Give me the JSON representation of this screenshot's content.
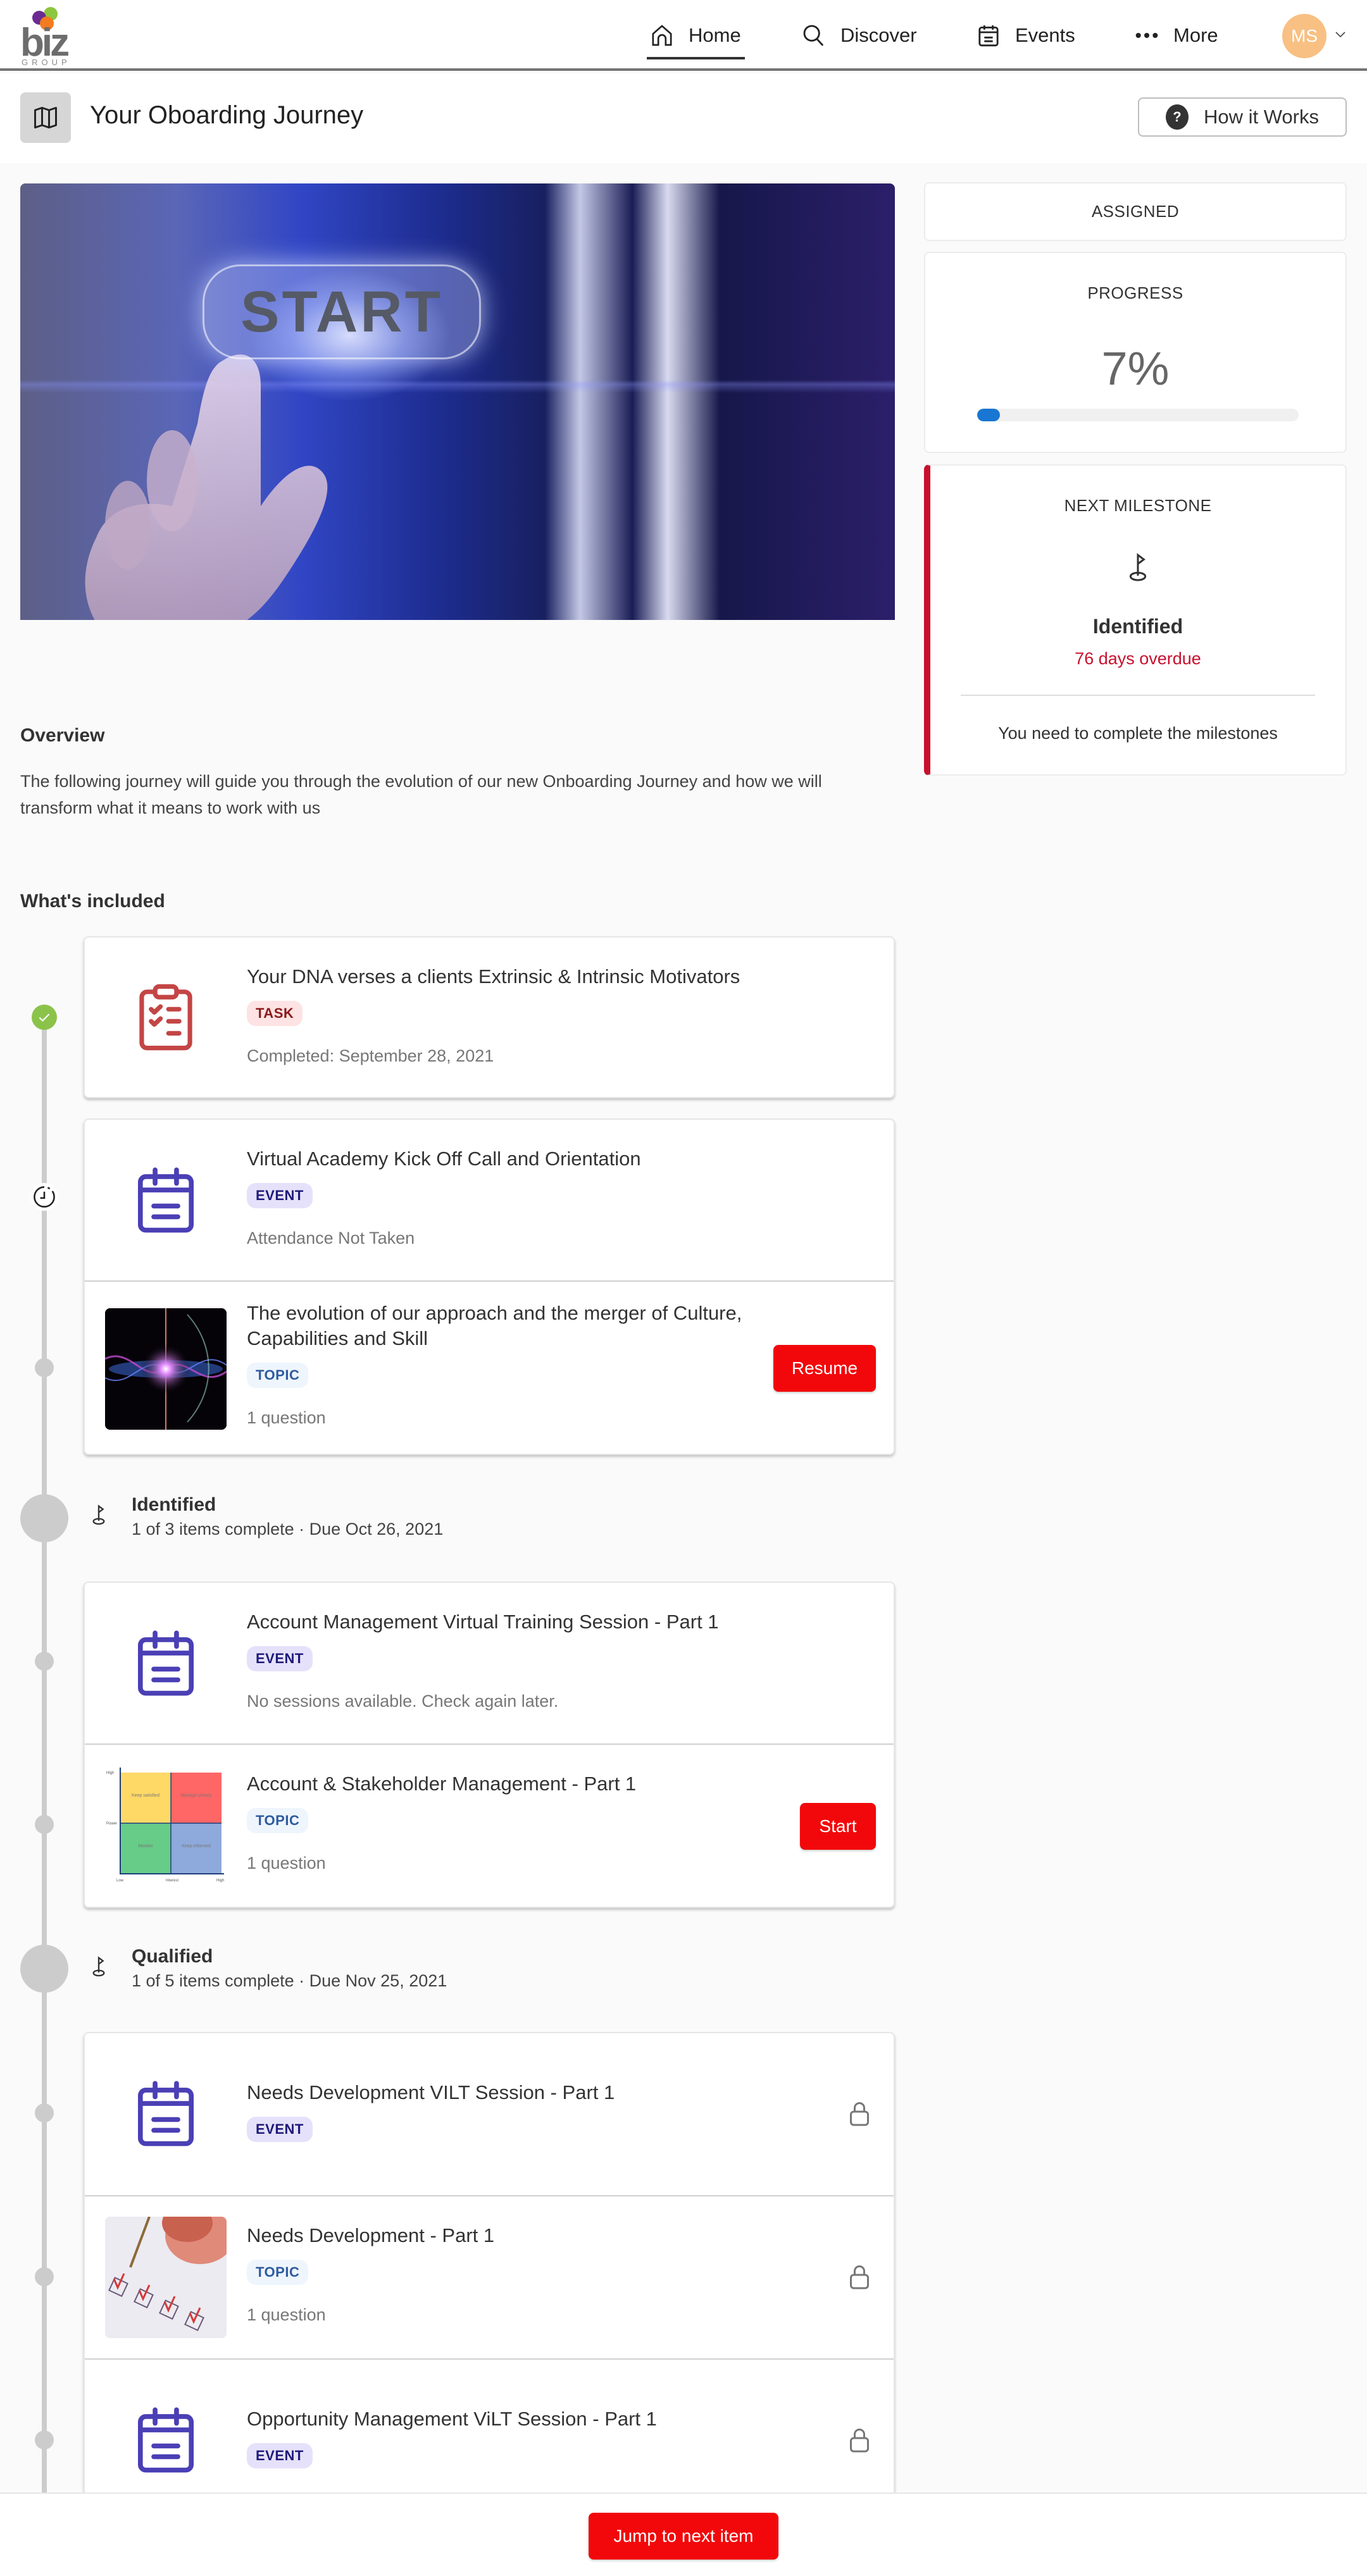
{
  "nav": {
    "logo_text": "biz",
    "logo_subtext": "GROUP",
    "items": [
      {
        "label": "Home",
        "icon": "home-icon",
        "active": true
      },
      {
        "label": "Discover",
        "icon": "search-icon",
        "active": false
      },
      {
        "label": "Events",
        "icon": "calendar-icon",
        "active": false
      },
      {
        "label": "More",
        "icon": "more-dots-icon",
        "active": false
      }
    ],
    "avatar_initials": "MS"
  },
  "header": {
    "title": "Your Oboarding Journey",
    "how_it_works_label": "How it Works"
  },
  "hero": {
    "image_text": "START"
  },
  "sidebar": {
    "status_label": "ASSIGNED",
    "progress_label": "PROGRESS",
    "progress_value": "7%",
    "progress_fraction": 0.07,
    "next_milestone_label": "NEXT MILESTONE",
    "next_milestone_name": "Identified",
    "next_milestone_overdue": "76 days overdue",
    "next_milestone_note": "You need to complete the milestones"
  },
  "overview": {
    "heading": "Overview",
    "text": "The following journey will guide you through the evolution of our new Onboarding Journey and how we will transform what it means to work with us"
  },
  "included": {
    "heading": "What's included",
    "groups": [
      {
        "items": [
          {
            "title": "Your DNA verses a clients Extrinsic & Intrinsic Motivators",
            "tag": "TASK",
            "meta": "Completed: September 28, 2021",
            "status": "completed"
          }
        ]
      },
      {
        "items": [
          {
            "title": "Virtual Academy Kick Off Call and Orientation",
            "tag": "EVENT",
            "meta": "Attendance Not Taken",
            "status": "pending"
          },
          {
            "title": "The evolution of our approach and the merger of Culture, Capabilities and Skill",
            "tag": "TOPIC",
            "meta": "1 question",
            "action": "Resume"
          }
        ]
      }
    ],
    "milestones": [
      {
        "name": "Identified",
        "summary": "1 of 3 items complete · Due Oct 26, 2021",
        "items": [
          {
            "title": "Account Management Virtual Training Session - Part 1",
            "tag": "EVENT",
            "meta": "No sessions available. Check again later."
          },
          {
            "title": "Account & Stakeholder Management - Part 1",
            "tag": "TOPIC",
            "meta": "1 question",
            "action": "Start",
            "thumb_labels": {
              "q1": "Keep satisfied",
              "q2": "Manage closely",
              "q3": "Monitor",
              "q4": "Keep informed",
              "y_high": "High",
              "y_mid": "Power",
              "x_low": "Low",
              "x_mid": "Interest",
              "x_high": "High"
            }
          }
        ]
      },
      {
        "name": "Qualified",
        "summary": "1 of 5 items complete · Due Nov 25, 2021",
        "items": [
          {
            "title": "Needs Development VILT Session - Part 1",
            "tag": "EVENT",
            "meta": "",
            "locked": true
          },
          {
            "title": "Needs Development - Part 1",
            "tag": "TOPIC",
            "meta": "1 question",
            "locked": true
          },
          {
            "title": "Opportunity Management ViLT Session - Part 1",
            "tag": "EVENT",
            "meta": "",
            "locked": true
          }
        ]
      }
    ]
  },
  "footer": {
    "jump_label": "Jump to next item"
  },
  "colors": {
    "accent_red": "#f2080b",
    "overdue_red": "#c8102e",
    "progress_blue": "#1976d2",
    "complete_green": "#8bc34a",
    "event_purple": "#4a3fb5",
    "task_red": "#c44545",
    "avatar_orange": "#f8c083"
  }
}
